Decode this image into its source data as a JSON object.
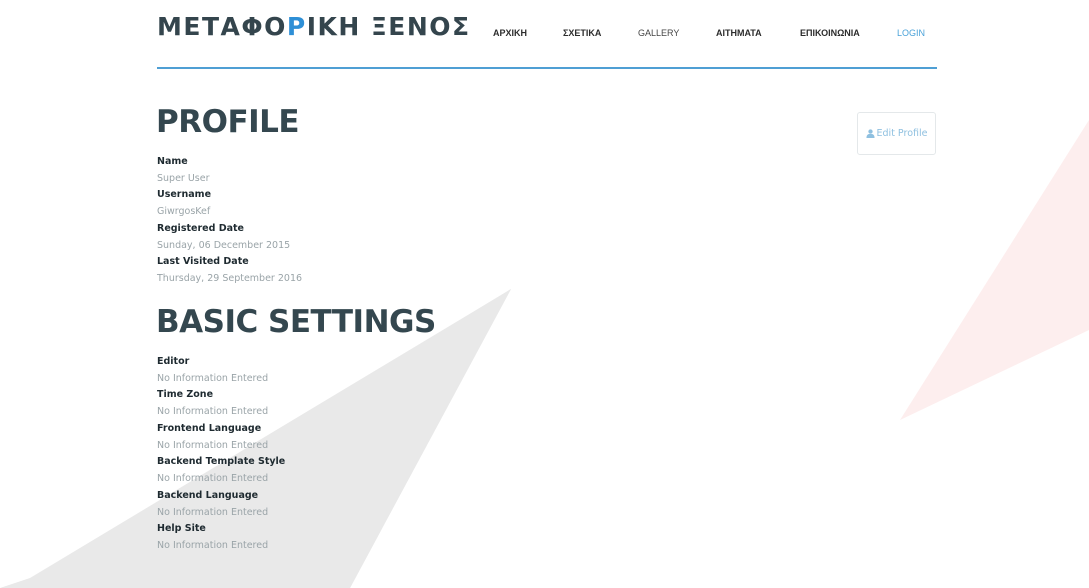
{
  "header": {
    "logo_part1": "ΜΕΤΑΦΟ",
    "logo_accent": "Ρ",
    "logo_part2": "ΙΚΗ ΞΕΝΟΣ",
    "nav": [
      {
        "label": "ΑΡΧΙΚΗ"
      },
      {
        "label": "ΣΧΕΤΙΚΑ"
      },
      {
        "label": "GALLERY"
      },
      {
        "label": "ΑΙΤΗΜΑΤΑ"
      },
      {
        "label": "ΕΠΙΚΟΙΝΩΝΙΑ"
      },
      {
        "label": "LOGIN"
      }
    ]
  },
  "profile": {
    "title": "PROFILE",
    "edit_button_label": "Edit Profile",
    "edit_button_icon": "user-icon",
    "fields": [
      {
        "label": "Name",
        "value": "Super User"
      },
      {
        "label": "Username",
        "value": "GiwrgosKef"
      },
      {
        "label": "Registered Date",
        "value": "Sunday, 06 December 2015"
      },
      {
        "label": "Last Visited Date",
        "value": "Thursday, 29 September 2016"
      }
    ]
  },
  "basic_settings": {
    "title": "BASIC SETTINGS",
    "fields": [
      {
        "label": "Editor",
        "value": "No Information Entered"
      },
      {
        "label": "Time Zone",
        "value": "No Information Entered"
      },
      {
        "label": "Frontend Language",
        "value": "No Information Entered"
      },
      {
        "label": "Backend Template Style",
        "value": "No Information Entered"
      },
      {
        "label": "Backend Language",
        "value": "No Information Entered"
      },
      {
        "label": "Help Site",
        "value": "No Information Entered"
      }
    ]
  },
  "colors": {
    "accent": "#2e8fd6",
    "heading": "#34474f",
    "rule": "#4f9fd4",
    "muted_text": "#9aa4a8"
  }
}
